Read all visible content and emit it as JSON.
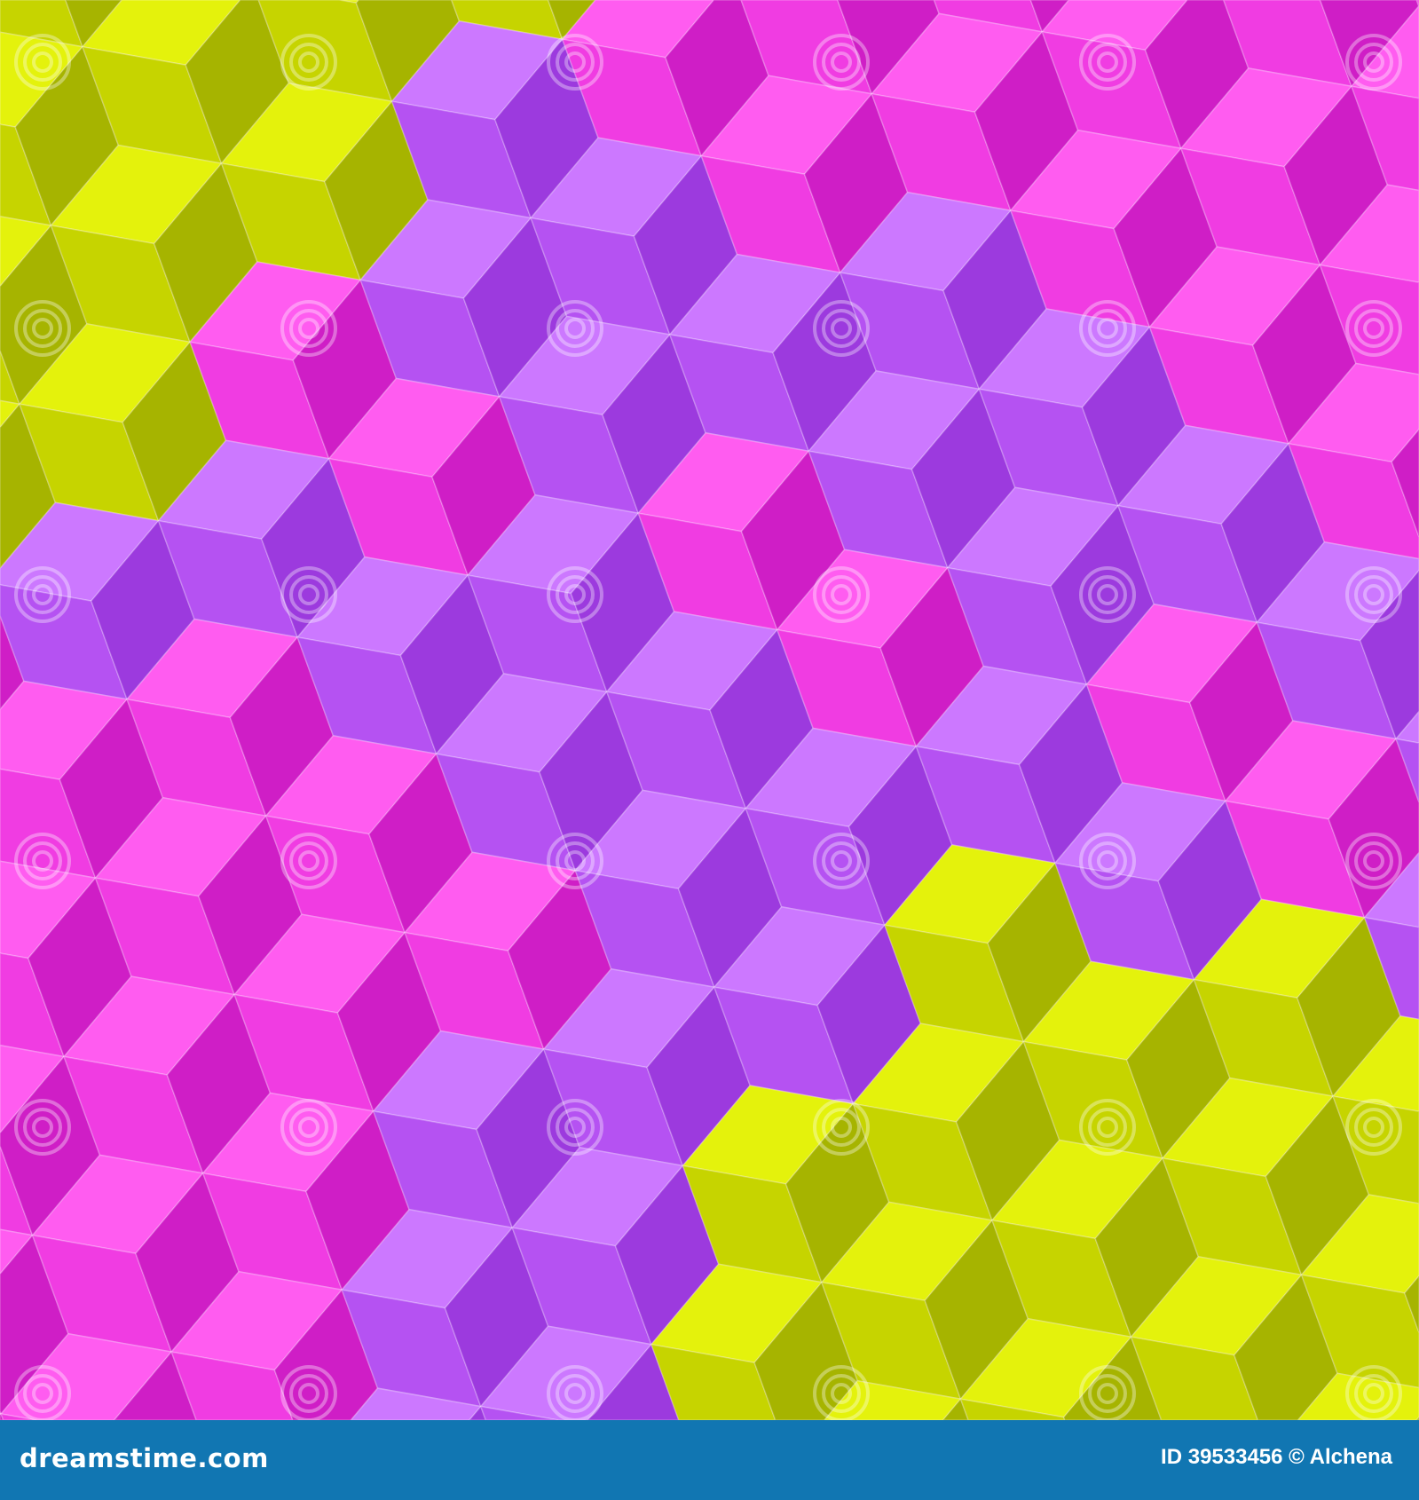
{
  "image": {
    "subject": "abstract cube pattern",
    "colors": {
      "lime": [
        "#e4f20c",
        "#c6d400",
        "#a6b400"
      ],
      "purple": [
        "#cc78ff",
        "#b552f2",
        "#9c3ade"
      ],
      "pink": [
        "#ff5cf0",
        "#f03ce2",
        "#cf1ec6"
      ],
      "bar": "#1176b2"
    },
    "watermark_text": "dreamstime"
  },
  "footer": {
    "site": "dreamstime.com",
    "credit": "ID 39533456 © Alchena"
  }
}
